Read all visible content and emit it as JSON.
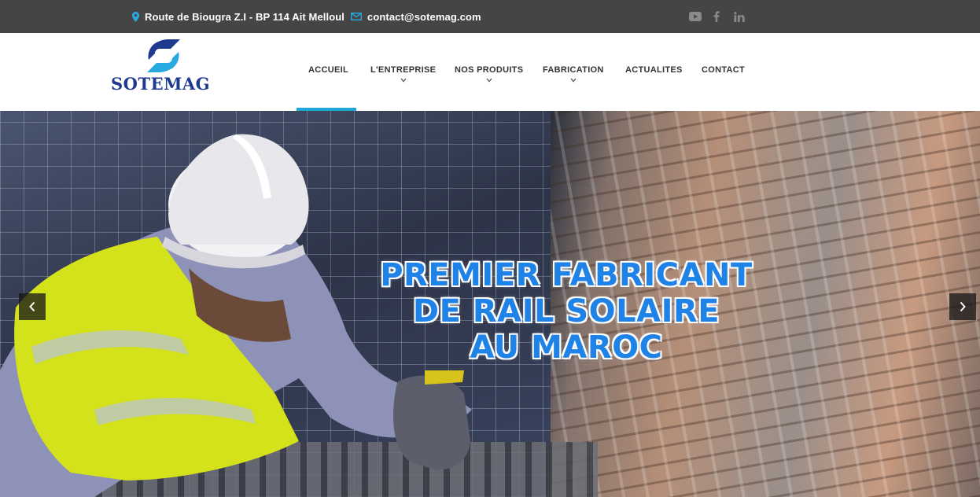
{
  "topbar": {
    "address": "Route de Biougra Z.I - BP 114 Ait Melloul",
    "email": "contact@sotemag.com",
    "social_icons": [
      "youtube-icon",
      "facebook-icon",
      "linkedin-icon"
    ]
  },
  "brand": {
    "name": "SOTEMAG",
    "logo_icon": "sotemag-s-logo"
  },
  "nav": {
    "items": [
      {
        "label": "ACCUEIL",
        "has_dropdown": false,
        "active": true
      },
      {
        "label": "L'ENTREPRISE",
        "has_dropdown": true,
        "active": false
      },
      {
        "label": "NOS PRODUITS",
        "has_dropdown": true,
        "active": false
      },
      {
        "label": "FABRICATION",
        "has_dropdown": true,
        "active": false
      },
      {
        "label": "ACTUALITES",
        "has_dropdown": false,
        "active": false
      },
      {
        "label": "CONTACT",
        "has_dropdown": false,
        "active": false
      }
    ]
  },
  "hero": {
    "title_lines": [
      "PREMIER FABRICANT",
      "DE RAIL SOLAIRE",
      "AU MAROC"
    ],
    "prev_icon": "chevron-left-icon",
    "next_icon": "chevron-right-icon"
  },
  "colors": {
    "topbar_bg": "#454545",
    "accent": "#1fa7d8",
    "hero_title": "#1e82e6",
    "brand_blue": "#1d3a8f"
  }
}
